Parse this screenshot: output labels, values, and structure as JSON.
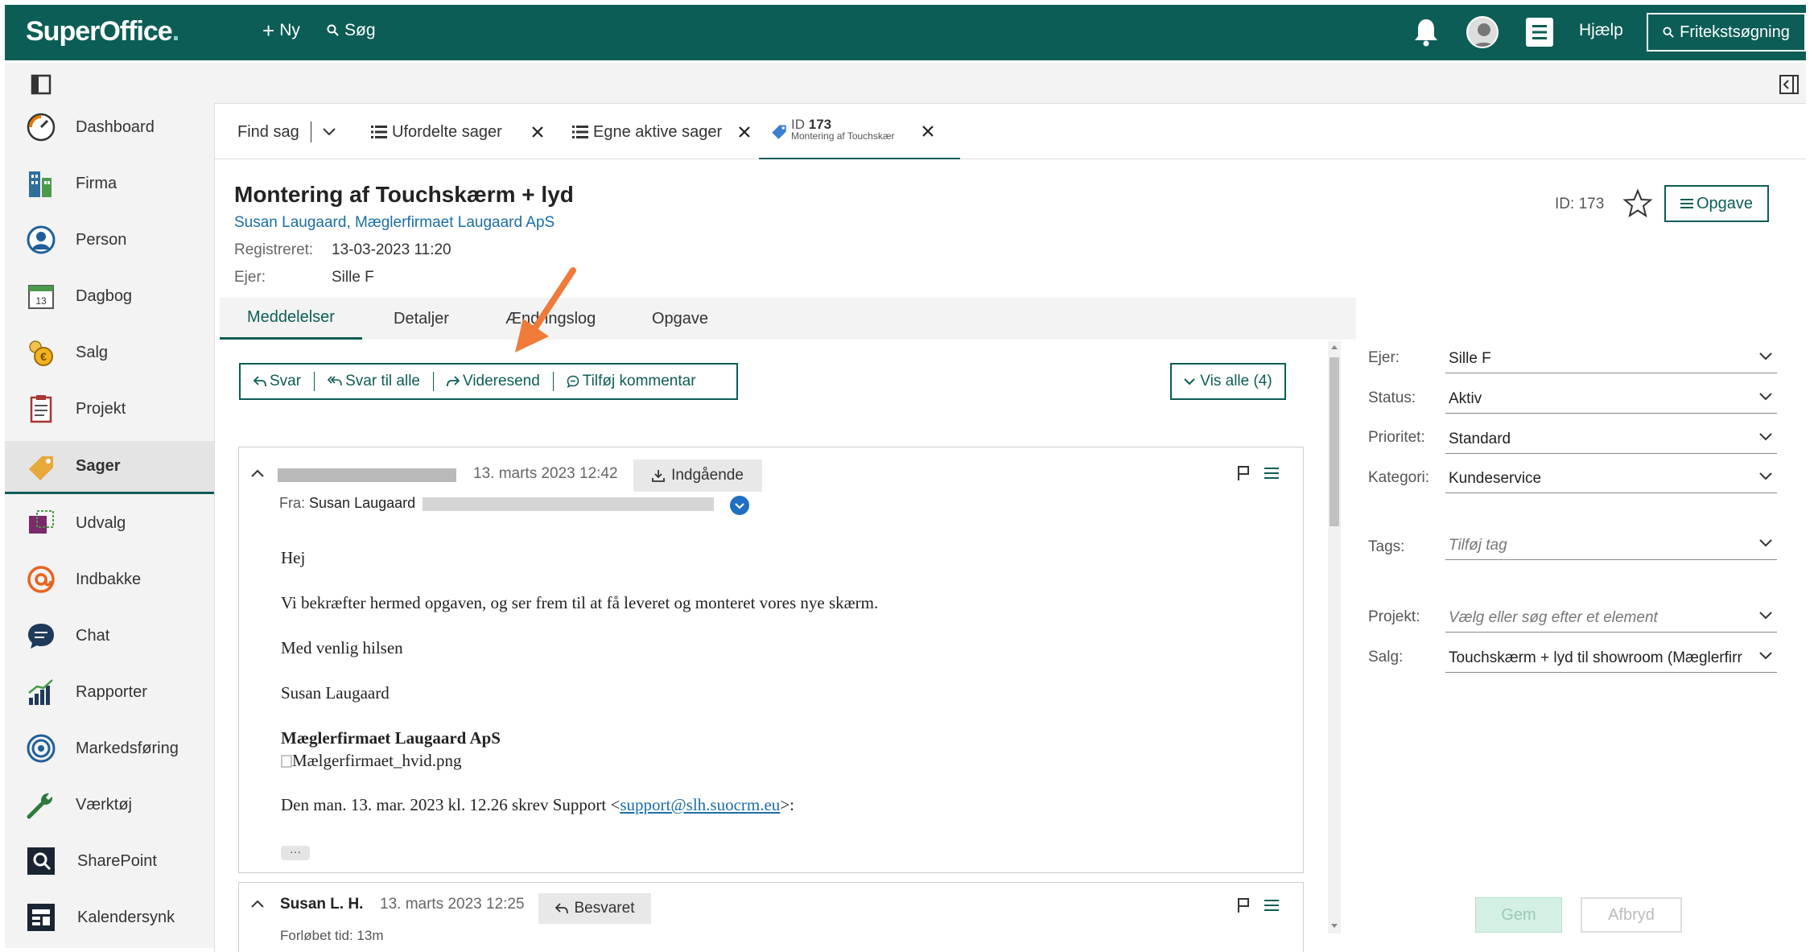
{
  "header": {
    "logo_text": "SuperOffice",
    "logo_dot": ".",
    "new_label": "Ny",
    "search_label": "Søg",
    "help_label": "Hjælp",
    "freetext_label": "Fritekstsøgning"
  },
  "nav": {
    "items": [
      {
        "label": "Dashboard",
        "icon": "dashboard-icon"
      },
      {
        "label": "Firma",
        "icon": "company-icon"
      },
      {
        "label": "Person",
        "icon": "person-icon"
      },
      {
        "label": "Dagbog",
        "icon": "calendar-icon"
      },
      {
        "label": "Salg",
        "icon": "sale-icon"
      },
      {
        "label": "Projekt",
        "icon": "project-icon"
      },
      {
        "label": "Sager",
        "icon": "request-icon",
        "active": true
      },
      {
        "label": "Udvalg",
        "icon": "selection-icon"
      },
      {
        "label": "Indbakke",
        "icon": "inbox-icon"
      },
      {
        "label": "Chat",
        "icon": "chat-icon"
      },
      {
        "label": "Rapporter",
        "icon": "reports-icon"
      },
      {
        "label": "Markedsføring",
        "icon": "marketing-icon"
      },
      {
        "label": "Værktøj",
        "icon": "tools-icon"
      },
      {
        "label": "SharePoint",
        "icon": "sharepoint-icon"
      },
      {
        "label": "Kalendersynk",
        "icon": "calendar-sync-icon"
      }
    ]
  },
  "tabs": {
    "find": "Find sag",
    "tab1": "Ufordelte sager",
    "tab2": "Egne aktive sager",
    "tab3_prefix": "ID",
    "tab3_id": "173",
    "tab3_sub": "Montering af Touchskær"
  },
  "ticket": {
    "title": "Montering af Touchskærm + lyd",
    "contact": "Susan Laugaard, Mæglerfirmaet Laugaard ApS",
    "registered_label": "Registreret:",
    "registered_value": "13-03-2023 11:20",
    "owner_label": "Ejer:",
    "owner_value": "Sille F",
    "id_label": "ID:",
    "id_value": "173",
    "opgave_label": "Opgave"
  },
  "subtabs": [
    "Meddelelser",
    "Detaljer",
    "Ændringslog",
    "Opgave"
  ],
  "actions": {
    "reply": "Svar",
    "reply_all": "Svar til alle",
    "forward": "Videresend",
    "comment": "Tilføj kommentar",
    "show_all": "Vis alle (4)"
  },
  "message1": {
    "date": "13. marts 2023 12:42",
    "direction": "Indgående",
    "from_label": "Fra:",
    "from_name": "Susan Laugaard",
    "greeting": "Hej",
    "body": "Vi bekræfter hermed opgaven, og ser frem til at få leveret og monteret vores nye skærm.",
    "closing": "Med venlig hilsen",
    "signature_name": "Susan Laugaard",
    "signature_company": "Mæglerfirmaet Laugaard ApS",
    "image_alt": "Mælgerfirmaet_hvid.png",
    "quote_prefix": "Den man. 13. mar. 2023 kl. 12.26 skrev Support <",
    "quote_email": "support@slh.suocrm.eu",
    "quote_suffix": ">:",
    "ellipsis": "···"
  },
  "message2": {
    "author": "Susan L. H.",
    "date": "13. marts 2023 12:25",
    "status": "Besvaret",
    "time_spent": "Forløbet tid: 13m"
  },
  "details": {
    "owner_label": "Ejer:",
    "owner": "Sille F",
    "status_label": "Status:",
    "status": "Aktiv",
    "priority_label": "Prioritet:",
    "priority": "Standard",
    "category_label": "Kategori:",
    "category": "Kundeservice",
    "tags_label": "Tags:",
    "tags_placeholder": "Tilføj tag",
    "project_label": "Projekt:",
    "project_placeholder": "Vælg eller søg efter et element",
    "sale_label": "Salg:",
    "sale": "Touchskærm + lyd til showroom (Mæglerfirr"
  },
  "footer": {
    "save": "Gem",
    "cancel": "Afbryd"
  },
  "colors": {
    "brand": "#0c5d56",
    "link": "#1a6ea8",
    "arrow": "#f07a3a"
  }
}
